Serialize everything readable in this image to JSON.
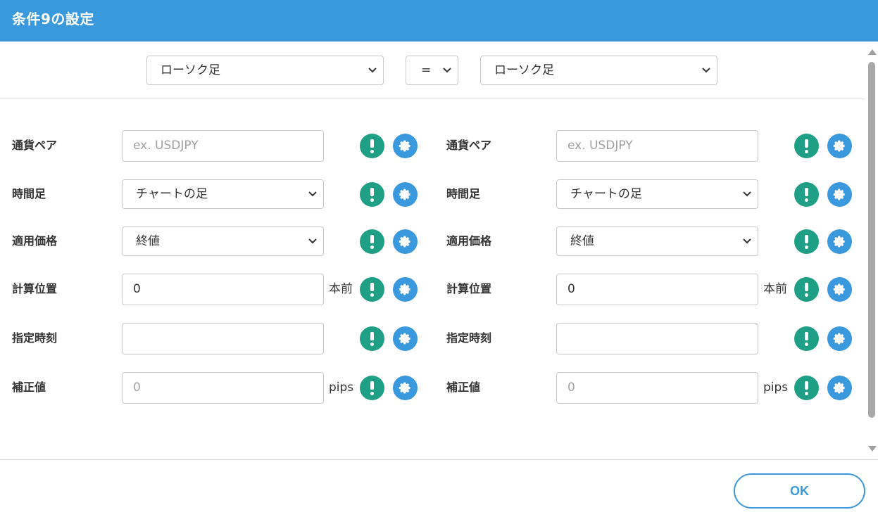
{
  "dialog": {
    "title": "条件9の設定"
  },
  "comparison": {
    "left_value": "ローソク足",
    "operator": "=",
    "right_value": "ローソク足"
  },
  "icons": {
    "info": "exclamation-icon",
    "settings": "gear-icon"
  },
  "colors": {
    "primary": "#3a98dc",
    "info_green": "#1f9f86"
  },
  "left": {
    "pair": {
      "label": "通貨ペア",
      "placeholder": "ex. USDJPY"
    },
    "timeframe": {
      "label": "時間足",
      "value": "チャートの足"
    },
    "price": {
      "label": "適用価格",
      "value": "終値"
    },
    "position": {
      "label": "計算位置",
      "value": "0",
      "unit": "本前"
    },
    "time": {
      "label": "指定時刻",
      "value": ""
    },
    "offset": {
      "label": "補正値",
      "placeholder": "0",
      "unit": "pips"
    }
  },
  "right": {
    "pair": {
      "label": "通貨ペア",
      "placeholder": "ex. USDJPY"
    },
    "timeframe": {
      "label": "時間足",
      "value": "チャートの足"
    },
    "price": {
      "label": "適用価格",
      "value": "終値"
    },
    "position": {
      "label": "計算位置",
      "value": "0",
      "unit": "本前"
    },
    "time": {
      "label": "指定時刻",
      "value": ""
    },
    "offset": {
      "label": "補正値",
      "placeholder": "0",
      "unit": "pips"
    }
  },
  "footer": {
    "ok_label": "OK"
  }
}
